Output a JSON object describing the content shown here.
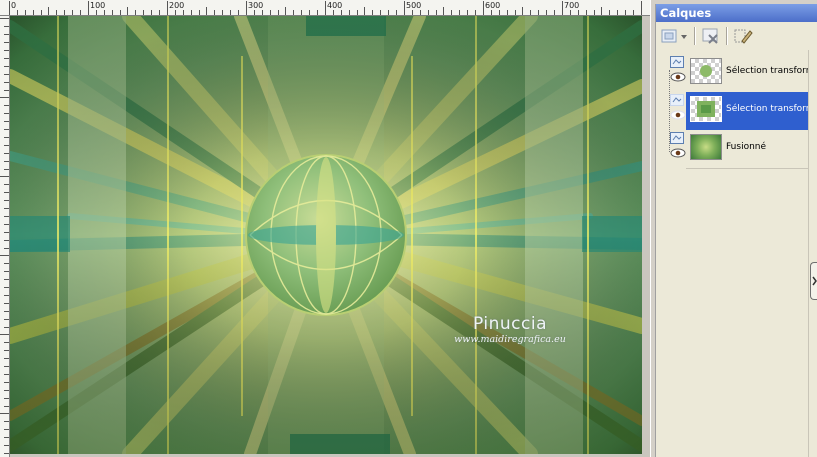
{
  "ruler": {
    "labels": [
      "0",
      "100",
      "200",
      "300",
      "400",
      "500",
      "600",
      "700"
    ]
  },
  "canvas": {
    "watermark_name": "Pinuccia",
    "watermark_url": "www.maidiregrafica.eu"
  },
  "layers_panel": {
    "title": "Calques",
    "layers": [
      {
        "name": "Sélection transforme",
        "selected": false,
        "thumb": "transparent-circle"
      },
      {
        "name": "Sélection transforme",
        "selected": true,
        "thumb": "transparent-green-square"
      },
      {
        "name": "Fusionné",
        "selected": false,
        "thumb": "green-texture"
      }
    ]
  },
  "colors": {
    "selection": "#2f5fcf",
    "panel_bg": "#ece9d8",
    "title_bar": "#5a7fd6"
  }
}
